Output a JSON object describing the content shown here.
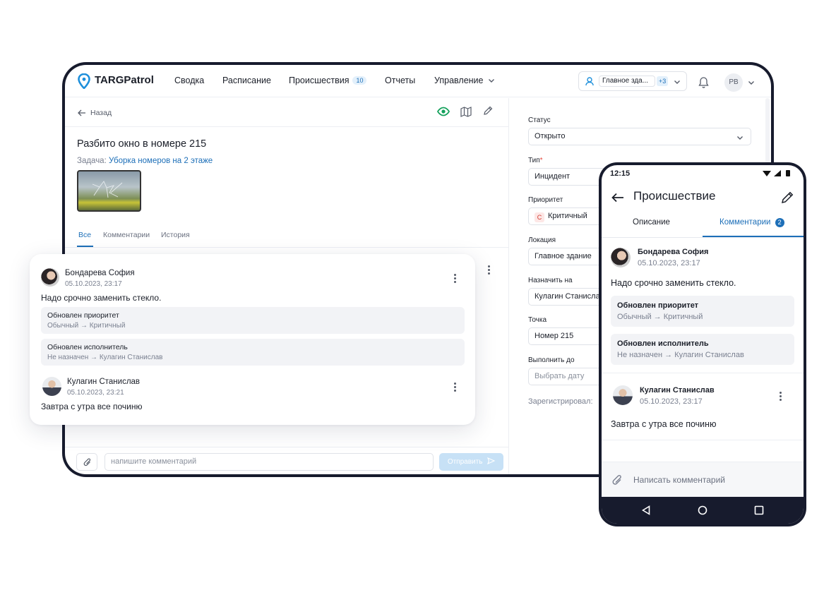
{
  "app": {
    "brand": "TARGPatrol",
    "nav": [
      {
        "label": "Сводка"
      },
      {
        "label": "Расписание"
      },
      {
        "label": "Происшествия",
        "badge": "10"
      },
      {
        "label": "Отчеты"
      },
      {
        "label": "Управление"
      }
    ],
    "building_chip": "Главное зда...",
    "building_more": "+3",
    "user_initials": "PB"
  },
  "incident": {
    "back_label": "Назад",
    "title": "Разбито окно в номере 215",
    "task_label": "Задача:",
    "task_link": "Уборка номеров на 2 этаже",
    "tabs": [
      "Все",
      "Комментарии",
      "История"
    ],
    "comment_placeholder": "напишите комментарий",
    "send_label": "Отправить"
  },
  "fields": {
    "status": {
      "label": "Статус",
      "value": "Открыто"
    },
    "type": {
      "label": "Тип",
      "required_mark": "*",
      "value": "Инцидент"
    },
    "priority": {
      "label": "Приоритет",
      "value": "Критичный",
      "tag": "C"
    },
    "location": {
      "label": "Локация",
      "value": "Главное здание"
    },
    "assignee": {
      "label": "Назначить на",
      "value": "Кулагин Станислав"
    },
    "point": {
      "label": "Точка",
      "value": "Номер 215"
    },
    "due": {
      "label": "Выполнить до",
      "placeholder": "Выбрать дату"
    },
    "registered_label": "Зарегистрировал:"
  },
  "comments": [
    {
      "author": "Бондарева София",
      "date": "05.10.2023, 23:17",
      "text": "Надо срочно заменить стекло.",
      "updates": [
        {
          "title": "Обновлен приоритет",
          "change": "Обычный → Критичный"
        },
        {
          "title": "Обновлен исполнитель",
          "change": "Не назначен → Кулагин Станислав"
        }
      ]
    },
    {
      "author": "Кулагин Станислав",
      "date": "05.10.2023, 23:21",
      "text": "Завтра с утра все починю"
    }
  ],
  "phone": {
    "time": "12:15",
    "title": "Происшествие",
    "tabs": [
      "Описание",
      "Комментарии"
    ],
    "comments_count": "2",
    "second_comment_date": "05.10.2023, 23:17",
    "write_placeholder": "Написать комментарий"
  },
  "colors": {
    "accent": "#1d6fb8",
    "eye_green": "#12a05a",
    "dark_frame": "#171b2d"
  }
}
